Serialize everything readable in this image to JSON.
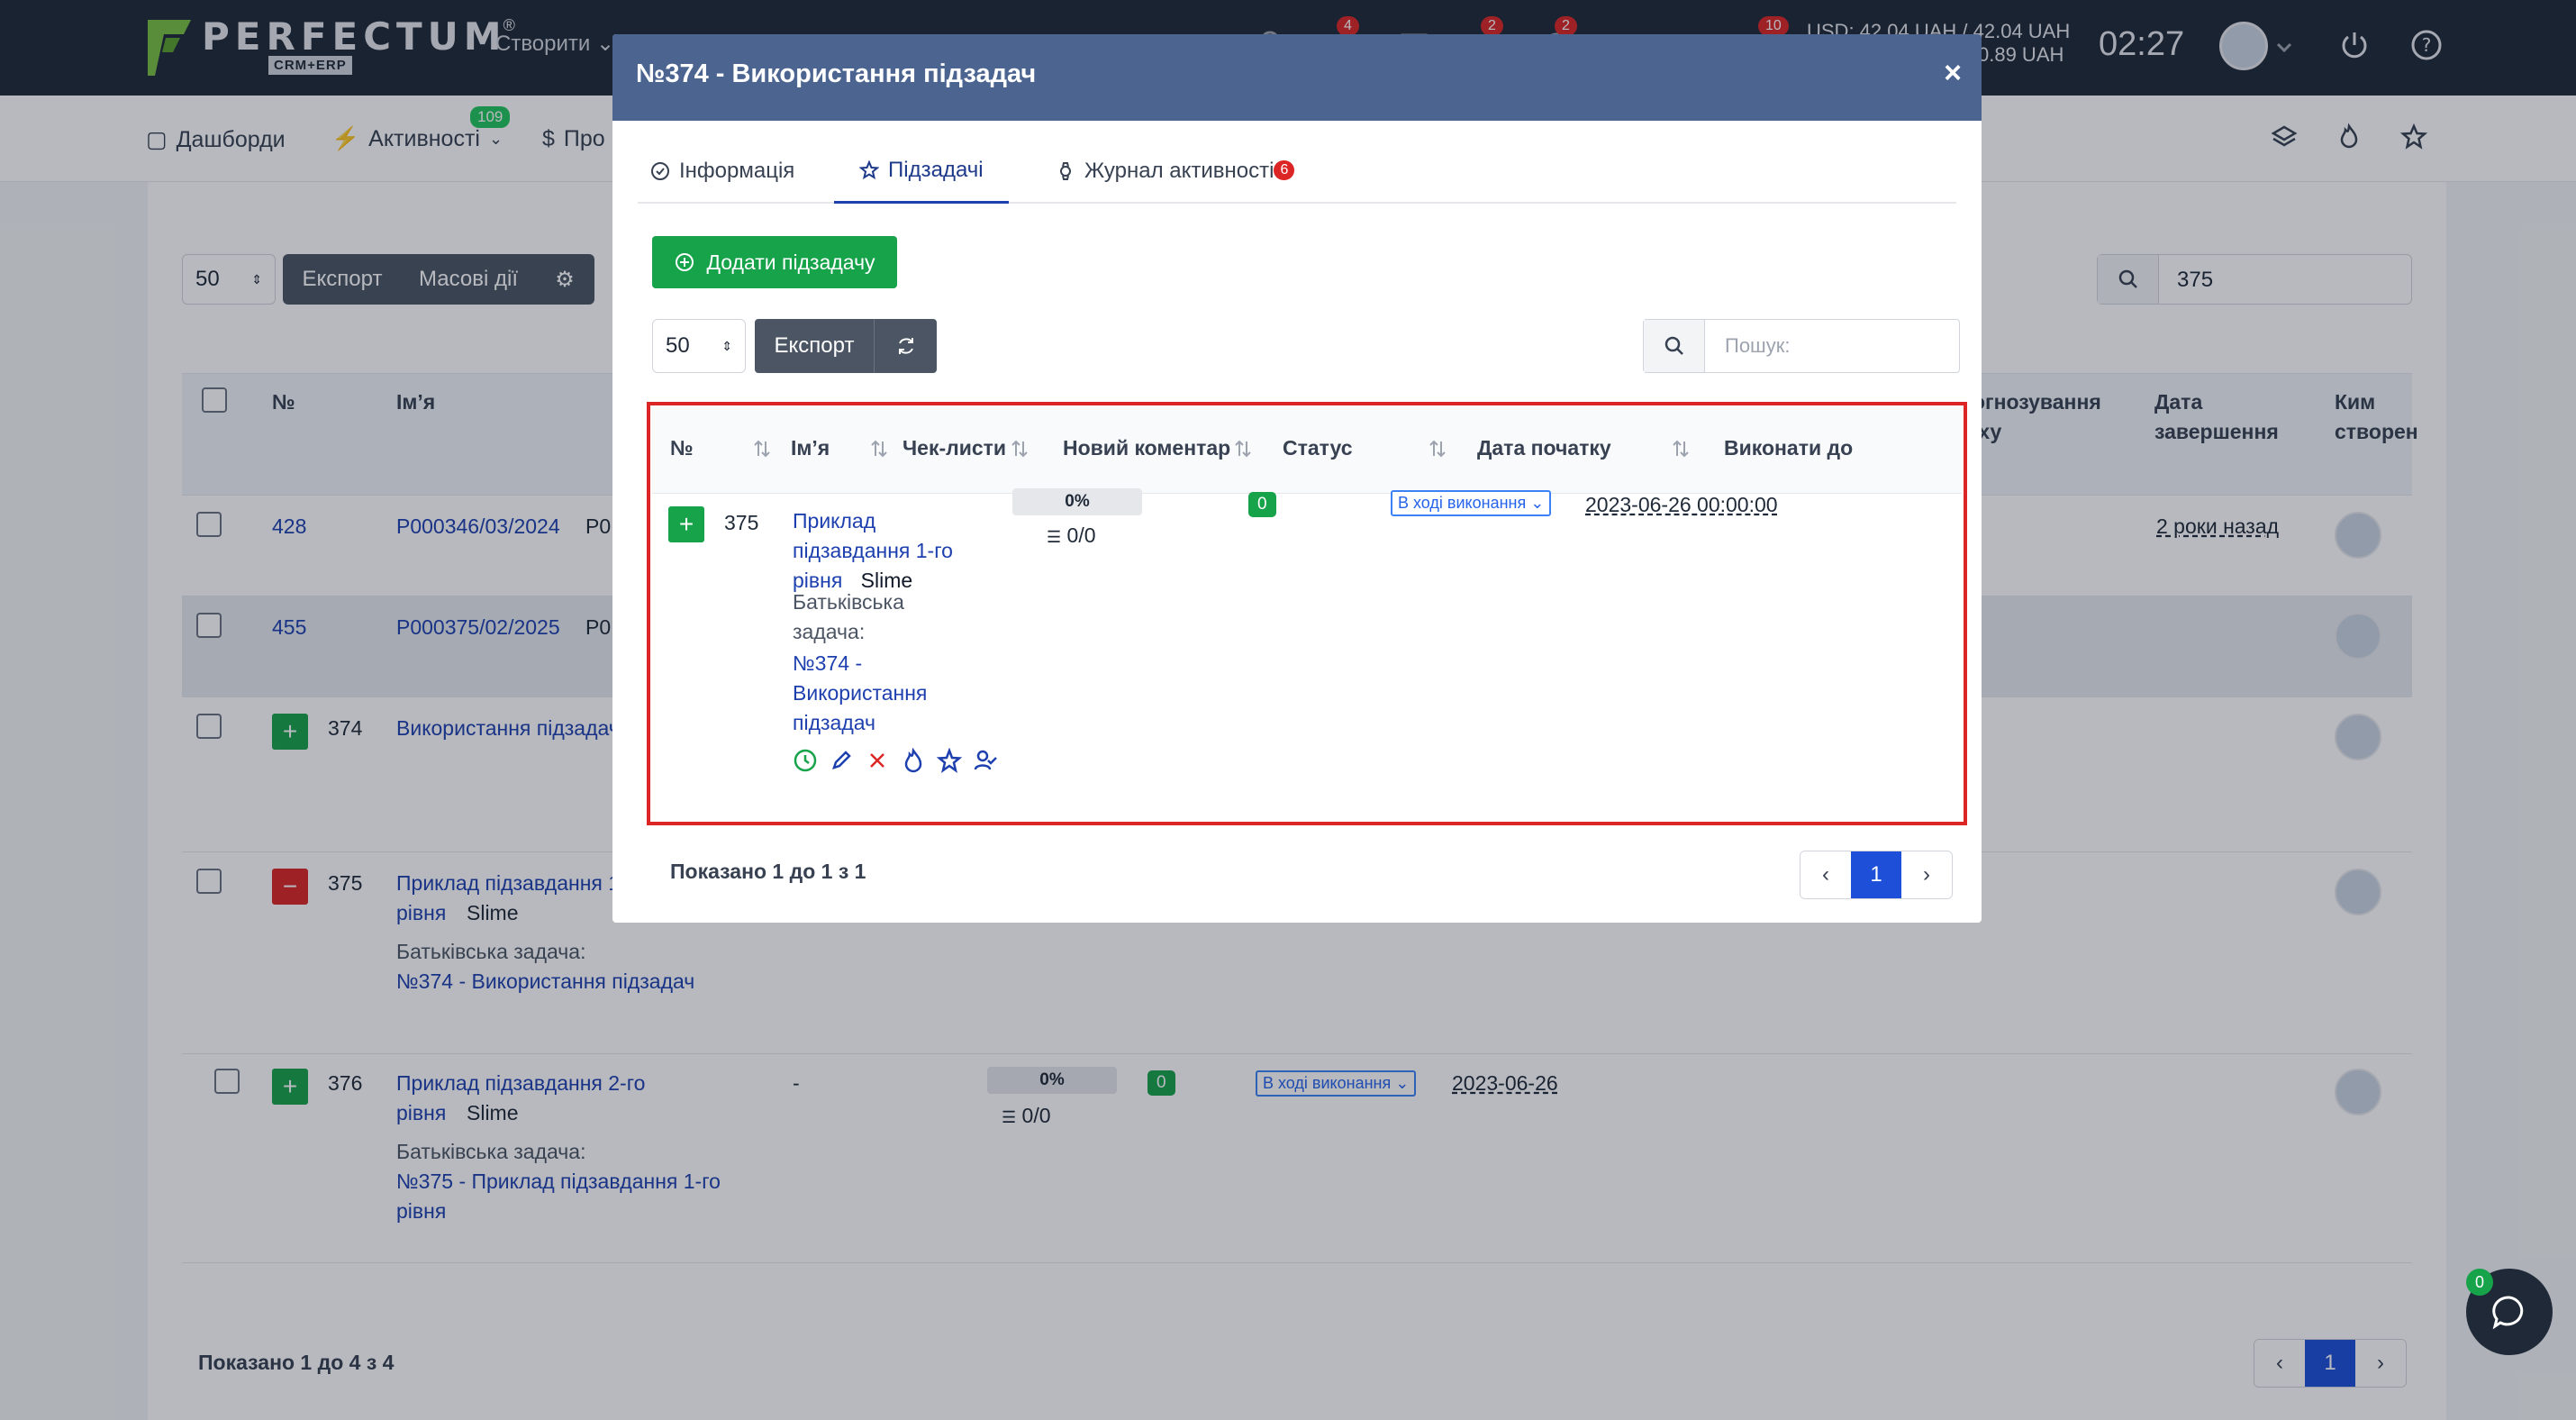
{
  "header": {
    "logo_text": "PERFECTUM",
    "logo_sub": "CRM+ERP",
    "logo_reg": "®",
    "create_label": "Створити",
    "badges": [
      "4",
      "2",
      "2",
      "10"
    ],
    "currency_line1": "USD: 42.04 UAH / 42.04 UAH",
    "currency_line2": "0.89 UAH",
    "clock": "02:27"
  },
  "subnav": {
    "dashboards": "Дашборди",
    "activities": "Активності",
    "activities_badge": "109",
    "projects": "Про"
  },
  "background": {
    "per_page": "50",
    "export_label": "Експорт",
    "bulk_label": "Масові дії",
    "search_value": "375",
    "columns": {
      "num": "№",
      "name": "Ім’я",
      "forecast": "огнозування\nіху",
      "end_date": "Дата\nзавершення",
      "created_by": "Ким\nстворен"
    },
    "rows": [
      {
        "num": "428",
        "code": "P000346/03/2024",
        "code_suffix": "P0",
        "end_date": "2 роки назад"
      },
      {
        "num": "455",
        "code": "P000375/02/2025",
        "code_suffix": "P0"
      },
      {
        "num": "374",
        "name": "Використання підзадач"
      },
      {
        "num": "375",
        "name": "Приклад підзавдання 1",
        "name2": "рівня",
        "tag": "Slime",
        "parent_label": "Батьківська задача:",
        "parent_link": "№374 - Використання підзадач"
      },
      {
        "num": "376",
        "name": "Приклад підзавдання 2-го",
        "name2": "рівня",
        "tag": "Slime",
        "parent_label": "Батьківська задача:",
        "parent_link": "№375 - Приклад підзавдання 1-го",
        "parent_link2": "рівня",
        "dash": "-",
        "progress": "0%",
        "checklist": "0/0",
        "comments": "0",
        "status": "В ході виконання",
        "start_date": "2023-06-26"
      }
    ],
    "footer_text": "Показано 1 до 4 з 4",
    "page": "1",
    "chat_badge": "0"
  },
  "modal": {
    "title": "№374 - Використання підзадач",
    "close": "×",
    "tabs": [
      {
        "label": "Інформація"
      },
      {
        "label": "Підзадачі"
      },
      {
        "label": "Журнал активності",
        "badge": "6"
      }
    ],
    "add_label": "Додати підзадачу",
    "per_page": "50",
    "export_label": "Експорт",
    "search_placeholder": "Пошук:",
    "columns": [
      "№",
      "Ім’я",
      "Чек-листи",
      "Новий коментар",
      "Статус",
      "Дата початку",
      "Виконати до"
    ],
    "row": {
      "num": "375",
      "name_lines": [
        "Приклад",
        "підзавдання 1-го",
        "рівня"
      ],
      "tag": "Slime",
      "parent_label_lines": [
        "Батьківська",
        "задача:"
      ],
      "parent_link_lines": [
        "№374 -",
        "Використання",
        "підзадач"
      ],
      "progress": "0%",
      "checklist": "0/0",
      "comments": "0",
      "status": "В ході виконання",
      "start_date": "2023-06-26 00:00:00"
    },
    "footer_text": "Показано 1 до 1 з 1",
    "page": "1"
  }
}
